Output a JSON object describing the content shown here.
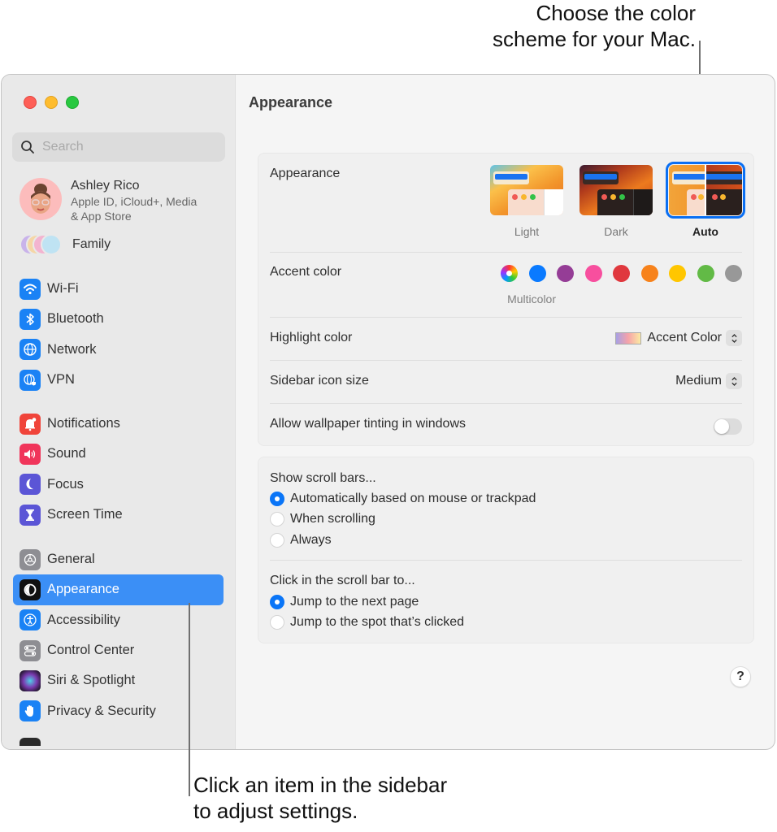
{
  "callouts": {
    "top": [
      "Choose the color",
      "scheme for your Mac."
    ],
    "bottom": [
      "Click an item in the sidebar",
      "to adjust settings."
    ]
  },
  "sidebar": {
    "search_placeholder": "Search",
    "account": {
      "name": "Ashley Rico",
      "subtitle_line1": "Apple ID, iCloud+, Media",
      "subtitle_line2": "& App Store"
    },
    "family_label": "Family",
    "groups": [
      [
        {
          "label": "Wi-Fi",
          "icon": "wifi-icon",
          "color": "#1a82f5"
        },
        {
          "label": "Bluetooth",
          "icon": "bluetooth-icon",
          "color": "#1a82f5"
        },
        {
          "label": "Network",
          "icon": "globe-icon",
          "color": "#1a82f5"
        },
        {
          "label": "VPN",
          "icon": "vpn-globe-icon",
          "color": "#1a82f5"
        }
      ],
      [
        {
          "label": "Notifications",
          "icon": "bell-icon",
          "color": "#f0443a"
        },
        {
          "label": "Sound",
          "icon": "speaker-icon",
          "color": "#f0355a"
        },
        {
          "label": "Focus",
          "icon": "moon-icon",
          "color": "#5b55d6"
        },
        {
          "label": "Screen Time",
          "icon": "hourglass-icon",
          "color": "#5b55d6"
        }
      ],
      [
        {
          "label": "General",
          "icon": "gear-icon",
          "color": "#8e8e93"
        },
        {
          "label": "Appearance",
          "icon": "appearance-icon",
          "color": "#111111",
          "selected": true
        },
        {
          "label": "Accessibility",
          "icon": "accessibility-icon",
          "color": "#1a82f5"
        },
        {
          "label": "Control Center",
          "icon": "toggles-icon",
          "color": "#8e8e93"
        },
        {
          "label": "Siri & Spotlight",
          "icon": "siri-icon",
          "color": "#6b2b6b"
        },
        {
          "label": "Privacy & Security",
          "icon": "hand-icon",
          "color": "#1a82f5"
        }
      ]
    ]
  },
  "main": {
    "title": "Appearance",
    "appearance": {
      "label": "Appearance",
      "options": [
        {
          "label": "Light",
          "selected": false
        },
        {
          "label": "Dark",
          "selected": false
        },
        {
          "label": "Auto",
          "selected": true
        }
      ]
    },
    "accent": {
      "label": "Accent color",
      "selected_label": "Multicolor",
      "colors": [
        "multicolor",
        "#0a7aff",
        "#953d96",
        "#f74f9e",
        "#e0383e",
        "#f7821b",
        "#ffc600",
        "#62ba46",
        "#989898"
      ]
    },
    "highlight": {
      "label": "Highlight color",
      "value": "Accent Color"
    },
    "sidebar_icon_size": {
      "label": "Sidebar icon size",
      "value": "Medium"
    },
    "wallpaper_tinting": {
      "label": "Allow wallpaper tinting in windows",
      "enabled": false
    },
    "scroll_bars": {
      "title": "Show scroll bars...",
      "options": [
        {
          "label": "Automatically based on mouse or trackpad",
          "checked": true
        },
        {
          "label": "When scrolling",
          "checked": false
        },
        {
          "label": "Always",
          "checked": false
        }
      ]
    },
    "click_scroll": {
      "title": "Click in the scroll bar to...",
      "options": [
        {
          "label": "Jump to the next page",
          "checked": true
        },
        {
          "label": "Jump to the spot that’s clicked",
          "checked": false
        }
      ]
    },
    "help_label": "?"
  },
  "colors": {
    "accent": "#0a75f7",
    "selection": "#3b8ff6"
  }
}
